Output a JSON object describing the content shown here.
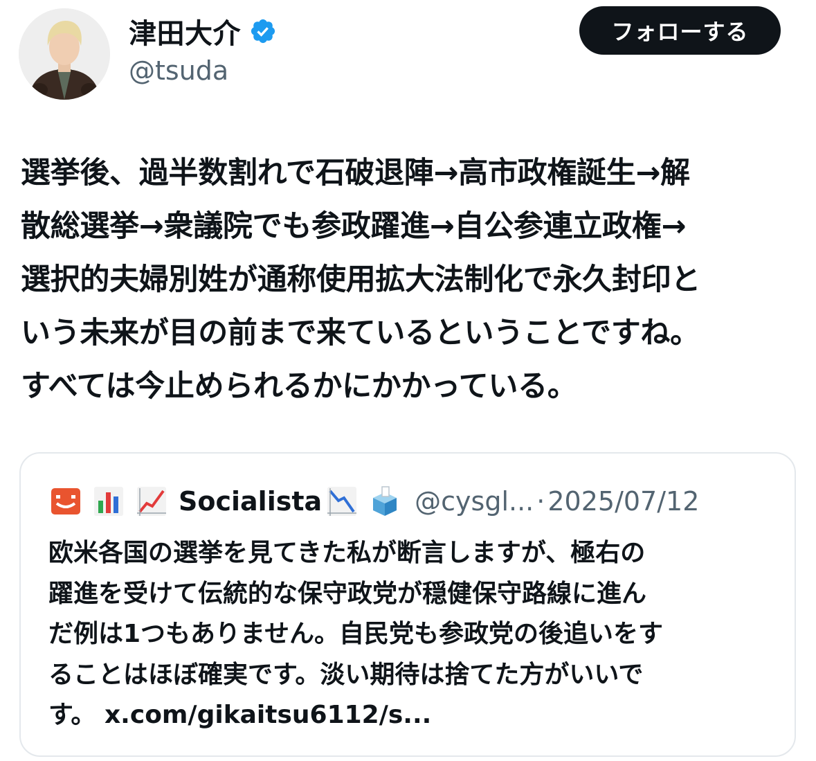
{
  "author": {
    "name": "津田大介",
    "handle": "@tsuda",
    "verified": true,
    "verified_color": "#1d9bf0"
  },
  "follow_button": {
    "label": "フォローする"
  },
  "tweet": {
    "text": "選挙後、過半数割れで石破退陣→高市政権誕生→解\n散総選挙→衆議院でも参政躍進→自公参連立政権→\n選択的夫婦別姓が通称使用拡大法制化で永久封印と\nいう未来が目の前まで来ているということですね。\nすべては今止められるかにかかっている。"
  },
  "quote": {
    "name": "Socialista",
    "handle": "@cysgl...",
    "separator": "·",
    "date": "2025/07/12",
    "icons": [
      "smiley-box-icon",
      "bar-chart-icon",
      "chart-increasing-icon",
      "chart-decreasing-icon",
      "ballot-box-icon"
    ],
    "text": "欧米各国の選挙を見てきた私が断言しますが、極右の\n躍進を受けて伝統的な保守政党が穏健保守路線に進ん\nだ例は1つもありません。自民党も参政党の後追いをす\nることはほぼ確実です。淡い期待は捨てた方がいいで\nす。",
    "link": "x.com/gikaitsu6112/s..."
  },
  "colors": {
    "text_primary": "#0f1419",
    "text_secondary": "#536471",
    "button_bg": "#0f1419",
    "border": "#e4e8ec"
  }
}
